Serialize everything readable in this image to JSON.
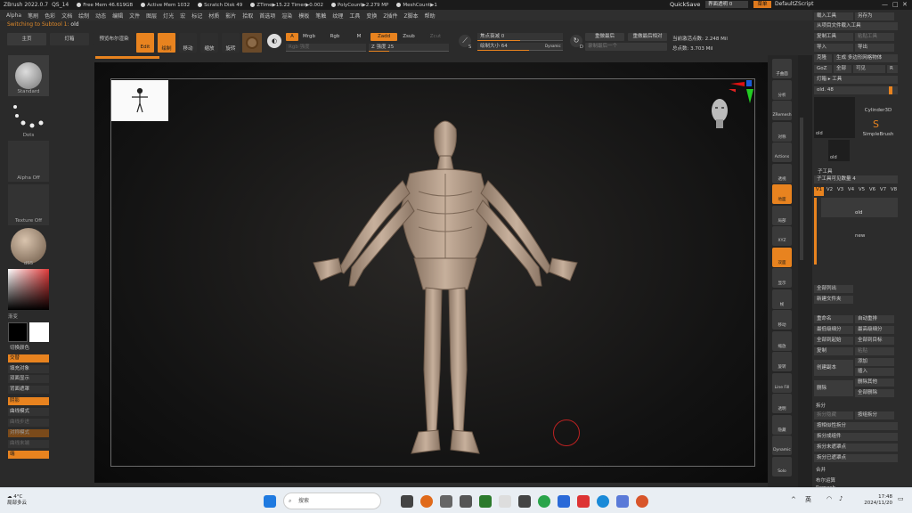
{
  "titlebar": {
    "app": "ZBrush 2022.0.7",
    "doc": "QS_14",
    "stats": [
      "Free Mem 46.619GB",
      "Active Mem 1032",
      "Scratch Disk 49",
      "ZTime▶15.22 Timer▶0.002",
      "PolyCount▶2.279 MP",
      "MeshCount▶1"
    ],
    "quicksave": "QuickSave",
    "interface_label": "界面透明 0",
    "menus": "菜单",
    "default_script": "DefaultZScript"
  },
  "menubar": [
    "Alpha",
    "笔刷",
    "色彩",
    "文档",
    "绘制",
    "动态",
    "编辑",
    "文件",
    "图层",
    "灯光",
    "宏",
    "标记",
    "材质",
    "影片",
    "拾取",
    "首选项",
    "渲染",
    "模板",
    "笔触",
    "纹理",
    "工具",
    "变换",
    "Z插件",
    "Z脚本",
    "帮助"
  ],
  "subtool_notice": {
    "prefix": "Switching to Subtool 1:",
    "name": "old"
  },
  "toolbar": {
    "home": "主页",
    "lightbox": "灯箱",
    "preview": "预览布尔渲染",
    "edit": "Edit",
    "draw": "绘制",
    "move": "移动",
    "scale": "缩放",
    "rotate": "旋转",
    "a": "A",
    "mrgb": "Mrgb",
    "rgb": "Rgb",
    "m": "M",
    "zadd": "Zadd",
    "zsub": "Zsub",
    "zcut": "Zcut",
    "rgb_intensity": "Rgb 强度",
    "z_intensity": "Z 强度 25",
    "focal_shift": "焦点衰减 0",
    "draw_size": "绘制大小 64",
    "dynamic": "Dynamic",
    "s": "S",
    "d": "D",
    "replay_last": "重做最后",
    "replay_last_rel": "重做最后相对",
    "record_last": "录制最后一个",
    "active_points": "当前激活点数: 2.248 Mil",
    "total_points": "总点数: 3.703 Mil"
  },
  "left": {
    "brush": "Standard",
    "stroke": "Dots",
    "alpha": "Alpha Off",
    "texture": "Texture Off",
    "material": "dS5",
    "gradient": "渐变",
    "switch_color": "切换颜色",
    "alternate": "交替",
    "fill_object": "填充对象",
    "double_sided": "双面显示",
    "backface_mask": "背面遮罩",
    "shadow": "阴影",
    "curve_mode": "曲线模式",
    "lazy_step": "曲线步进",
    "symm_mode": "对称模式",
    "curve_closed": "曲线末端",
    "cap": "端"
  },
  "right": {
    "load_tool": "载入工具",
    "save_as": "另存为",
    "load_from_project": "从项目文件载入工具",
    "copy_tool": "复制工具",
    "paste_tool": "粘贴工具",
    "import": "导入",
    "export": "导出",
    "clone": "克隆",
    "make_polymesh": "生成 多边形网格物体",
    "goz": "GoZ",
    "all": "全部",
    "visible": "可见",
    "r": "R",
    "lightbox_tools": "灯箱 ▸ 工具",
    "old_48": "old. 48",
    "tool_old": "old",
    "tool_cyl": "Cylinder3D",
    "tool_simple": "SimpleBrush",
    "tool_old2": "old",
    "subtool_header": "子工具",
    "visible_count": "子工具可见数量 4",
    "versions": [
      "V1",
      "V2",
      "V3",
      "V4",
      "V5",
      "V6",
      "V7",
      "V8"
    ],
    "sub_old": "old",
    "sub_new": "new",
    "list_all": "全部列出",
    "new_folder": "新建文件夹",
    "rename": "重命名",
    "auto_reorder": "自动重排",
    "lowest_res": "最低级细分",
    "highest_res": "最高级细分",
    "all_low": "全部到起始",
    "all_high": "全部到目标",
    "duplicate": "复制",
    "append": "粘贴",
    "create_insert": "创建副本",
    "add": "添加",
    "insert": "插入",
    "delete": "删除",
    "del_other": "删除其他",
    "del_all": "全部删除",
    "split": "拆分",
    "split_hidden": "拆分隐藏",
    "groups_split": "按组拆分",
    "poly_split": "按相似性拆分",
    "split_parts": "拆分成组件",
    "split_unmasked": "拆分未遮罩点",
    "split_masked": "拆分已遮罩点",
    "merge": "合并",
    "boolean": "布尔运算",
    "remesh": "Remesh"
  },
  "shelf": [
    "子曲面",
    "分析",
    "ZRemesh",
    "对称",
    "Actions",
    "透视",
    "地面",
    "局部",
    "XYZ",
    "双面",
    "显示",
    "帧",
    "移动",
    "缩放",
    "旋转",
    "Line Fill",
    "透明",
    "隐藏",
    "Dynamic",
    "Solo"
  ],
  "taskbar": {
    "temp": "4°C",
    "weather": "局部多云",
    "search": "搜索",
    "lang": "英",
    "time": "17:48",
    "date": "2024/11/20"
  },
  "colors": {
    "accent": "#e8831f",
    "primary_color": "#000000",
    "secondary_color": "#ffffff"
  }
}
